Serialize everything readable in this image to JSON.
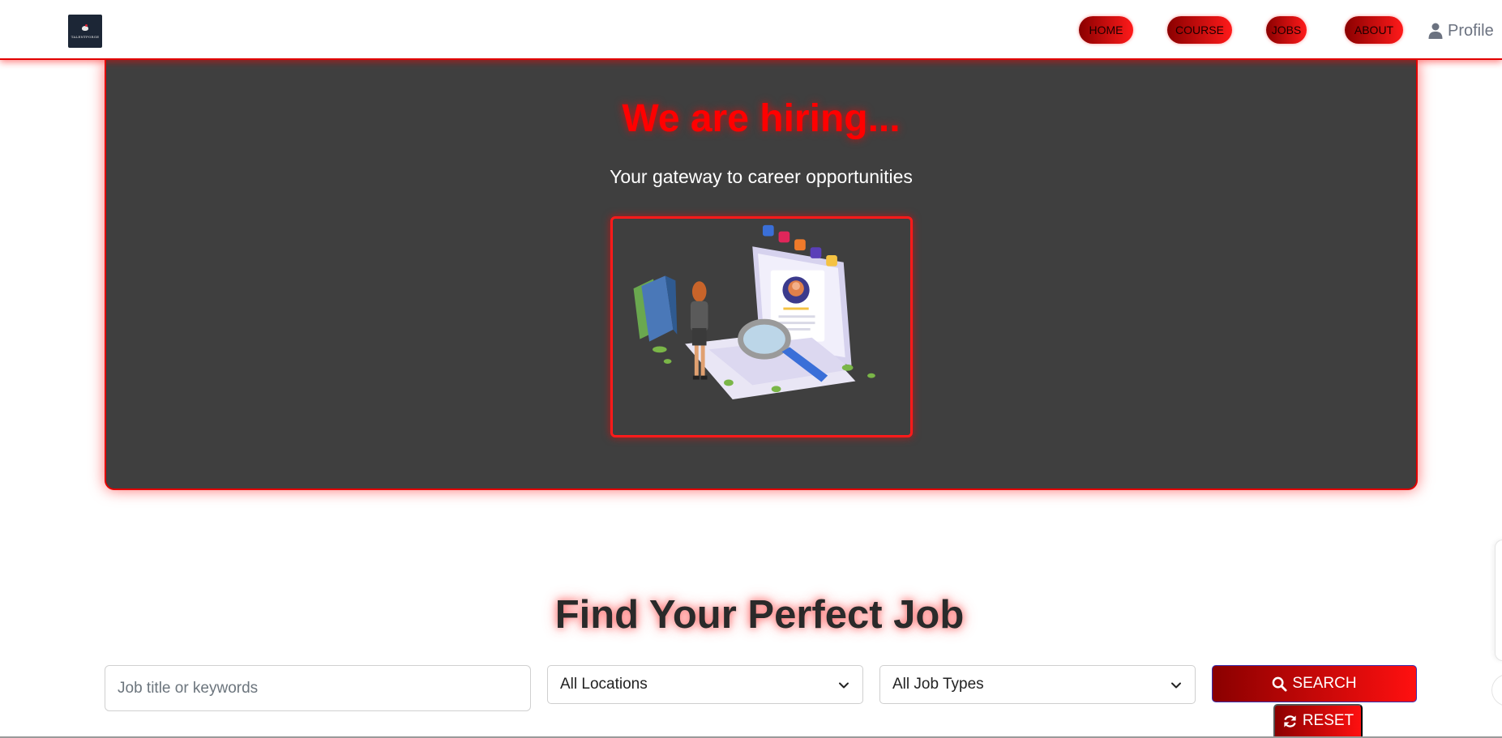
{
  "navbar": {
    "logo_text": "TALENTFORGE",
    "links": [
      {
        "label": "HOME"
      },
      {
        "label": "COURSE"
      },
      {
        "label": "JOBS"
      },
      {
        "label": "ABOUT"
      }
    ],
    "profile_label": "Profile",
    "profile_icon": "user-icon"
  },
  "hero": {
    "title": "We are hiring...",
    "subtitle": "Your gateway to career opportunities",
    "illustration": "recruiter-search-illustration"
  },
  "search": {
    "title": "Find Your Perfect Job",
    "keywords_placeholder": "Job title or keywords",
    "keywords_value": "",
    "location_selected": "All Locations",
    "job_type_selected": "All Job Types",
    "search_label": "SEARCH",
    "search_icon": "search-icon",
    "reset_label": "RESET",
    "reset_icon": "refresh-icon"
  },
  "colors": {
    "accent": "#ff0000",
    "accent_dark": "#8a0000",
    "hero_bg": "#3f3f3f",
    "heading_text": "#2a2a2a"
  }
}
